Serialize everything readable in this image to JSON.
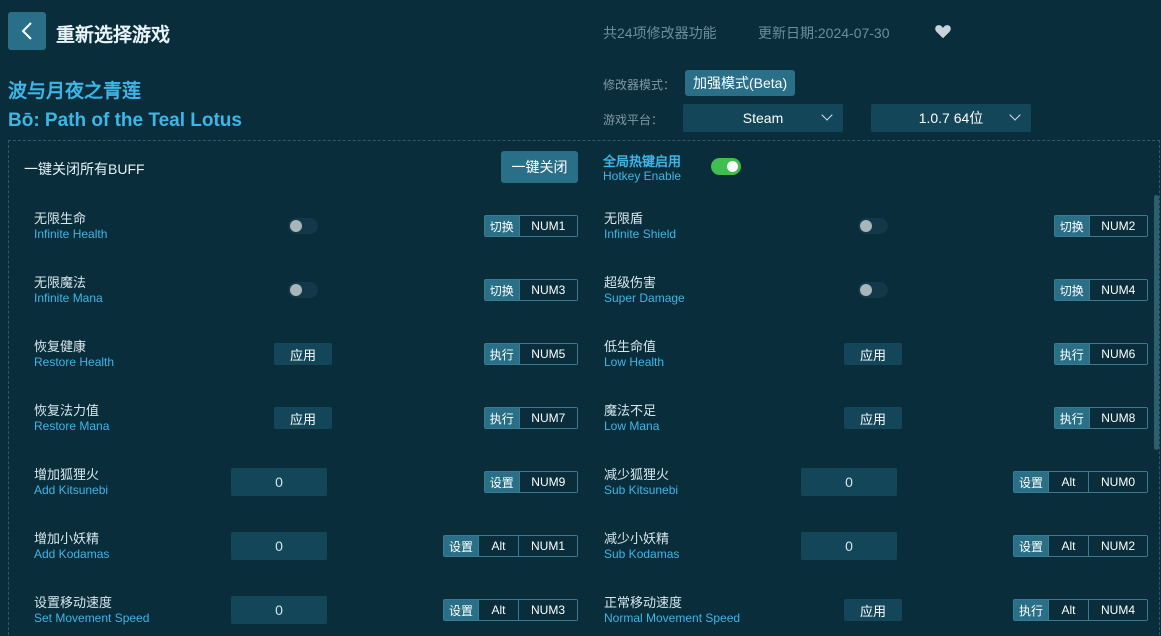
{
  "header": {
    "title": "重新选择游戏",
    "feature_count": "共24项修改器功能",
    "update_date": "更新日期:2024-07-30"
  },
  "game": {
    "name_cn": "波与月夜之青莲",
    "name_en": "Bō: Path of the Teal Lotus"
  },
  "settings": {
    "mode_label": "修改器模式：",
    "mode_value": "加强模式(Beta)",
    "platform_label": "游戏平台：",
    "platform_value": "Steam",
    "version_value": "1.0.7 64位"
  },
  "global": {
    "close_all_label": "一键关闭所有BUFF",
    "close_all_button": "一键关闭",
    "hotkey_cn": "全局热键启用",
    "hotkey_en": "Hotkey Enable",
    "hotkey_enabled": true
  },
  "cheats": [
    {
      "cn": "无限生命",
      "en": "Infinite Health",
      "control": "toggle",
      "action": "切换",
      "keys": [
        "NUM1"
      ]
    },
    {
      "cn": "无限盾",
      "en": "Infinite Shield",
      "control": "toggle",
      "action": "切换",
      "keys": [
        "NUM2"
      ]
    },
    {
      "cn": "无限魔法",
      "en": "Infinite Mana",
      "control": "toggle",
      "action": "切换",
      "keys": [
        "NUM3"
      ]
    },
    {
      "cn": "超级伤害",
      "en": "Super Damage",
      "control": "toggle",
      "action": "切换",
      "keys": [
        "NUM4"
      ]
    },
    {
      "cn": "恢复健康",
      "en": "Restore Health",
      "control": "apply",
      "apply_label": "应用",
      "action": "执行",
      "keys": [
        "NUM5"
      ]
    },
    {
      "cn": "低生命值",
      "en": "Low Health",
      "control": "apply",
      "apply_label": "应用",
      "action": "执行",
      "keys": [
        "NUM6"
      ]
    },
    {
      "cn": "恢复法力值",
      "en": "Restore Mana",
      "control": "apply",
      "apply_label": "应用",
      "action": "执行",
      "keys": [
        "NUM7"
      ]
    },
    {
      "cn": "魔法不足",
      "en": "Low Mana",
      "control": "apply",
      "apply_label": "应用",
      "action": "执行",
      "keys": [
        "NUM8"
      ]
    },
    {
      "cn": "增加狐狸火",
      "en": "Add Kitsunebi",
      "control": "input",
      "value": "0",
      "action": "设置",
      "keys": [
        "NUM9"
      ]
    },
    {
      "cn": "减少狐狸火",
      "en": "Sub Kitsunebi",
      "control": "input",
      "value": "0",
      "action": "设置",
      "keys": [
        "Alt",
        "NUM0"
      ]
    },
    {
      "cn": "增加小妖精",
      "en": "Add Kodamas",
      "control": "input",
      "value": "0",
      "action": "设置",
      "keys": [
        "Alt",
        "NUM1"
      ]
    },
    {
      "cn": "减少小妖精",
      "en": "Sub Kodamas",
      "control": "input",
      "value": "0",
      "action": "设置",
      "keys": [
        "Alt",
        "NUM2"
      ]
    },
    {
      "cn": "设置移动速度",
      "en": "Set Movement Speed",
      "control": "input",
      "value": "0",
      "action": "设置",
      "keys": [
        "Alt",
        "NUM3"
      ]
    },
    {
      "cn": "正常移动速度",
      "en": "Normal Movement Speed",
      "control": "apply",
      "apply_label": "应用",
      "action": "执行",
      "keys": [
        "Alt",
        "NUM4"
      ]
    }
  ]
}
